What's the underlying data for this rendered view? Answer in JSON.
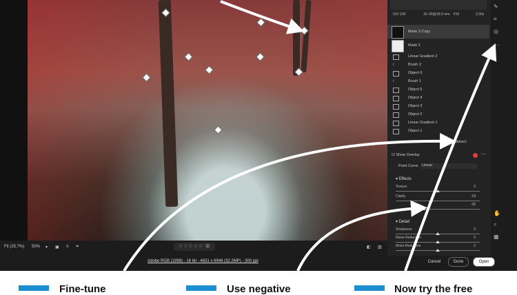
{
  "panel": {
    "meta": {
      "iso": "ISO 100",
      "lens": "16–35@18.0 mm",
      "aperture": "f/16",
      "shutter": "3.30s"
    },
    "layers": [
      {
        "label": "Mask 3 Copy",
        "kind": "mask"
      },
      {
        "label": "Mask 2",
        "kind": "mask"
      },
      {
        "label": "Linear Gradient 2",
        "kind": "gradient"
      },
      {
        "label": "Brush 2",
        "kind": "brush"
      },
      {
        "label": "Object 6",
        "kind": "object"
      },
      {
        "label": "Brush 1",
        "kind": "brush"
      },
      {
        "label": "Object 5",
        "kind": "object"
      },
      {
        "label": "Object 4",
        "kind": "object"
      },
      {
        "label": "Object 3",
        "kind": "object"
      },
      {
        "label": "Object 2",
        "kind": "object"
      },
      {
        "label": "Linear Gradient 1",
        "kind": "gradient"
      },
      {
        "label": "Object 1",
        "kind": "object"
      }
    ],
    "add_label": "Add",
    "subtract_label": "Subtract",
    "show_overlay_label": "Show Overlay",
    "overlay_color": "#d9443a",
    "point_curve_label": "Point Curve",
    "point_curve_value": "Linear",
    "effects_title": "Effects",
    "effects": [
      {
        "label": "Texture",
        "value": "0",
        "pos": 0.5
      },
      {
        "label": "Clarity",
        "value": "-18",
        "pos": 0.41
      },
      {
        "label": "Dehaze",
        "value": "-36",
        "pos": 0.32
      }
    ],
    "detail_title": "Detail",
    "detail": [
      {
        "label": "Sharpness",
        "value": "0",
        "pos": 0.5
      },
      {
        "label": "Noise Reduction",
        "value": "0",
        "pos": 0.5
      },
      {
        "label": "Moire Reduction",
        "value": "0",
        "pos": 0.5
      }
    ]
  },
  "statusbar": {
    "fit_label": "Fit (25.7%)",
    "zoom": "50%"
  },
  "footer": {
    "image_info": "Adobe RGB (1998) - 16 bit - 4631 x 6946 (32.2MP) - 300 ppi",
    "cancel_label": "Cancel",
    "done_label": "Done",
    "open_label": "Open"
  },
  "captions": [
    "Fine-tune",
    "Use negative",
    "Now try the free"
  ],
  "colors": {
    "caption_accent": "#1d8fd0",
    "panel_bg": "#232323"
  }
}
